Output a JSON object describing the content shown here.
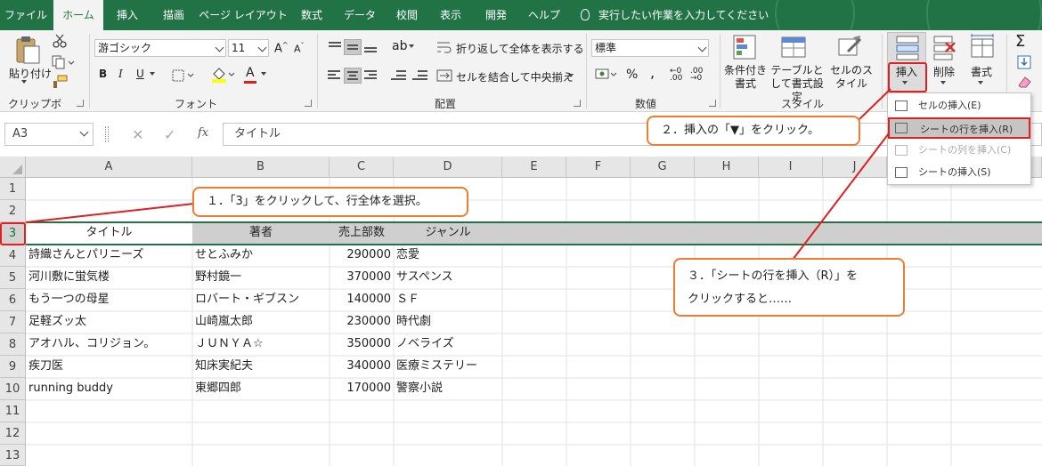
{
  "tabs": [
    "ファイル",
    "ホーム",
    "挿入",
    "描画",
    "ページ レイアウト",
    "数式",
    "データ",
    "校閲",
    "表示",
    "開発",
    "ヘルプ"
  ],
  "active_tab": "ホーム",
  "tell_me": "実行したい作業を入力してください",
  "ribbon": {
    "clipboard": {
      "paste": "貼り付け",
      "label": "クリップボード"
    },
    "font": {
      "name": "游ゴシック",
      "size": "11",
      "bold": "B",
      "italic": "I",
      "underline": "U",
      "label": "フォント"
    },
    "alignment": {
      "wrap": "折り返して全体を表示する",
      "merge": "セルを結合して中央揃え",
      "label": "配置"
    },
    "number": {
      "format": "標準",
      "percent": "%",
      "comma": ",",
      "label": "数値"
    },
    "styles": {
      "conditional": "条件付き書式",
      "table": "テーブルとして書式設定",
      "cell": "セルのスタイル",
      "label": "スタイル"
    },
    "cells": {
      "insert": "挿入",
      "delete": "削除",
      "format": "書式"
    },
    "editing": {
      "sum": "Σ"
    }
  },
  "insert_menu": [
    {
      "label": "セルの挿入(E)",
      "state": "normal"
    },
    {
      "label": "シートの行を挿入(R)",
      "state": "highlighted"
    },
    {
      "label": "シートの列を挿入(C)",
      "state": "disabled"
    },
    {
      "label": "シートの挿入(S)",
      "state": "normal"
    }
  ],
  "formula_bar": {
    "name_box": "A3",
    "fx": "fx",
    "value": "タイトル"
  },
  "columns": [
    "A",
    "B",
    "C",
    "D",
    "E",
    "F",
    "G",
    "H",
    "I",
    "J"
  ],
  "rows": [
    "1",
    "2",
    "3",
    "4",
    "5",
    "6",
    "7",
    "8",
    "9",
    "10",
    "11",
    "12",
    "13"
  ],
  "table": {
    "headers": [
      "タイトル",
      "著者",
      "売上部数",
      "ジャンル"
    ],
    "rows": [
      [
        "詩織さんとパリニーズ",
        "せとふみか",
        "290000",
        "恋愛"
      ],
      [
        "河川敷に蛍気楼",
        "野村鏡一",
        "370000",
        "サスペンス"
      ],
      [
        "もう一つの母星",
        "ロバート・ギブスン",
        "140000",
        "ＳＦ"
      ],
      [
        "足軽ズッ太",
        "山崎嵐太郎",
        "230000",
        "時代劇"
      ],
      [
        "アオハル、コリジョン。",
        "ＪＵＮＹＡ☆",
        "350000",
        "ノベライズ"
      ],
      [
        "疾刀医",
        "知床実紀夫",
        "340000",
        "医療ミステリー"
      ],
      [
        "running buddy",
        "東郷四郎",
        "170000",
        "警察小説"
      ]
    ]
  },
  "callouts": {
    "step1": "１．「3」をクリックして、行全体を選択。",
    "step2": "２．挿入の「▼」をクリック。",
    "step3_line1": "３．「シートの行を挿入（R）」を",
    "step3_line2": "クリックすると……"
  },
  "colors": {
    "excel_green": "#217346",
    "callout_border": "#ed7d31",
    "highlight_red": "#e02020"
  }
}
